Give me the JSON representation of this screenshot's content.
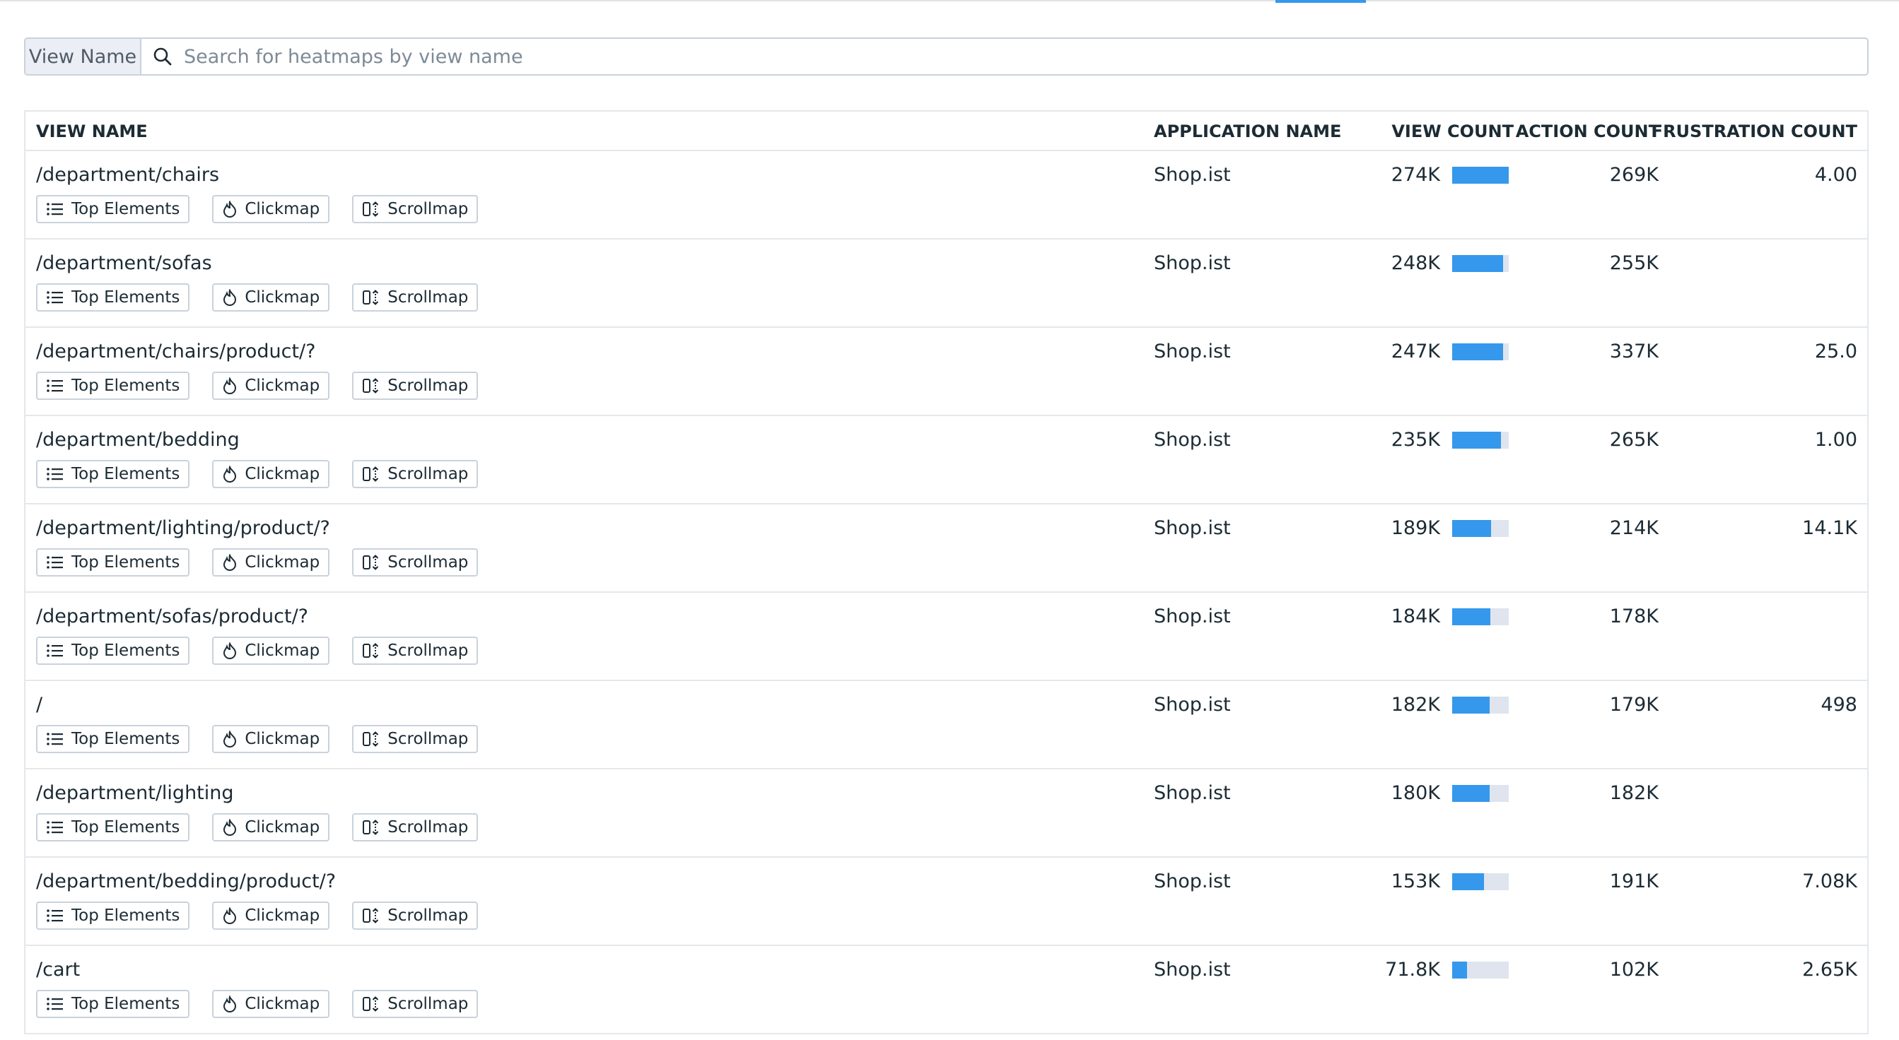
{
  "colors": {
    "accent": "#3598ec",
    "bar_track": "#dfe4ee",
    "border": "#c9d2dc",
    "text": "#1c2b34"
  },
  "search": {
    "prefix_label": "View Name",
    "placeholder": "Search for heatmaps by view name",
    "icon": "search-icon"
  },
  "table": {
    "columns": {
      "view_name": "VIEW NAME",
      "application_name": "APPLICATION NAME",
      "view_count": "VIEW COUNT",
      "action_count": "ACTION COUNT",
      "frustration_count": "FRUSTRATION COUNT"
    },
    "action_labels": {
      "top_elements": "Top Elements",
      "clickmap": "Clickmap",
      "scrollmap": "Scrollmap"
    },
    "rows": [
      {
        "view_name": "/department/chairs",
        "application": "Shop.ist",
        "view_count": "274K",
        "view_fraction": 1.0,
        "action_count": "269K",
        "frustration_count": "4.00"
      },
      {
        "view_name": "/department/sofas",
        "application": "Shop.ist",
        "view_count": "248K",
        "view_fraction": 0.905,
        "action_count": "255K",
        "frustration_count": ""
      },
      {
        "view_name": "/department/chairs/product/?",
        "application": "Shop.ist",
        "view_count": "247K",
        "view_fraction": 0.901,
        "action_count": "337K",
        "frustration_count": "25.0"
      },
      {
        "view_name": "/department/bedding",
        "application": "Shop.ist",
        "view_count": "235K",
        "view_fraction": 0.858,
        "action_count": "265K",
        "frustration_count": "1.00"
      },
      {
        "view_name": "/department/lighting/product/?",
        "application": "Shop.ist",
        "view_count": "189K",
        "view_fraction": 0.69,
        "action_count": "214K",
        "frustration_count": "14.1K"
      },
      {
        "view_name": "/department/sofas/product/?",
        "application": "Shop.ist",
        "view_count": "184K",
        "view_fraction": 0.672,
        "action_count": "178K",
        "frustration_count": ""
      },
      {
        "view_name": "/",
        "application": "Shop.ist",
        "view_count": "182K",
        "view_fraction": 0.664,
        "action_count": "179K",
        "frustration_count": "498"
      },
      {
        "view_name": "/department/lighting",
        "application": "Shop.ist",
        "view_count": "180K",
        "view_fraction": 0.657,
        "action_count": "182K",
        "frustration_count": ""
      },
      {
        "view_name": "/department/bedding/product/?",
        "application": "Shop.ist",
        "view_count": "153K",
        "view_fraction": 0.558,
        "action_count": "191K",
        "frustration_count": "7.08K"
      },
      {
        "view_name": "/cart",
        "application": "Shop.ist",
        "view_count": "71.8K",
        "view_fraction": 0.262,
        "action_count": "102K",
        "frustration_count": "2.65K"
      }
    ]
  }
}
